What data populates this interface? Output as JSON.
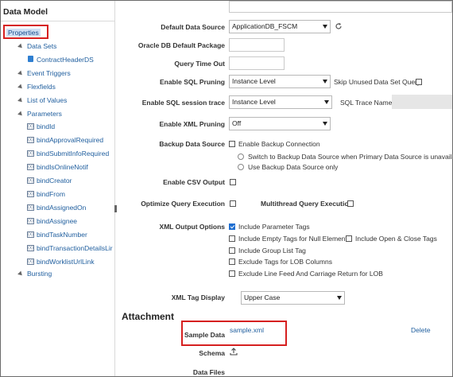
{
  "left_panel": {
    "title": "Data Model",
    "selected": "Properties",
    "tree": {
      "data_sets": "Data Sets",
      "data_set_item": "ContractHeaderDS",
      "event_triggers": "Event Triggers",
      "flexfields": "Flexfields",
      "list_of_values": "List of Values",
      "parameters": "Parameters",
      "params": [
        "bindId",
        "bindApprovalRequired",
        "bindSubmitInfoRequired",
        "bindIsOnlineNotif",
        "bindCreator",
        "bindFrom",
        "bindAssignedOn",
        "bindAssignee",
        "bindTaskNumber",
        "bindTransactionDetailsLir",
        "bindWorklistUrlLink"
      ],
      "bursting": "Bursting"
    }
  },
  "properties": {
    "default_data_source_label": "Default Data Source",
    "default_data_source_value": "ApplicationDB_FSCM",
    "oracle_pkg_label": "Oracle DB Default Package",
    "oracle_pkg_value": "",
    "query_timeout_label": "Query Time Out",
    "query_timeout_value": "",
    "sql_pruning_label": "Enable SQL Pruning",
    "sql_pruning_value": "Instance Level",
    "skip_unused_label": "Skip Unused Data Set Query",
    "sql_session_label": "Enable SQL session trace",
    "sql_session_value": "Instance Level",
    "sql_trace_name_label": "SQL Trace Name",
    "xml_pruning_label": "Enable XML Pruning",
    "xml_pruning_value": "Off",
    "backup_label": "Backup Data Source",
    "enable_backup_label": "Enable Backup Connection",
    "switch_backup_label": "Switch to Backup Data Source when Primary Data Source is unavailable",
    "use_backup_label": "Use Backup Data Source only",
    "csv_label": "Enable CSV Output",
    "optimize_label": "Optimize Query Execution",
    "multithread_label": "Multithread Query Execution",
    "xml_output_label": "XML Output Options",
    "opt_include_params": "Include Parameter Tags",
    "opt_include_empty": "Include Empty Tags for Null Elements",
    "opt_include_open_close": "Include Open & Close Tags",
    "opt_include_group": "Include Group List Tag",
    "opt_exclude_lob": "Exclude Tags for LOB Columns",
    "opt_exclude_linefeed": "Exclude Line Feed And Carriage Return for LOB",
    "xml_tag_display_label": "XML Tag Display",
    "xml_tag_display_value": "Upper Case"
  },
  "attachment": {
    "heading": "Attachment",
    "sample_data_label": "Sample Data",
    "sample_file": "sample.xml",
    "delete_label": "Delete",
    "schema_label": "Schema",
    "data_files_label": "Data Files"
  },
  "colors": {
    "accent": "#1f5e9e",
    "highlight": "#d62020",
    "selection": "#cfe0f4"
  }
}
